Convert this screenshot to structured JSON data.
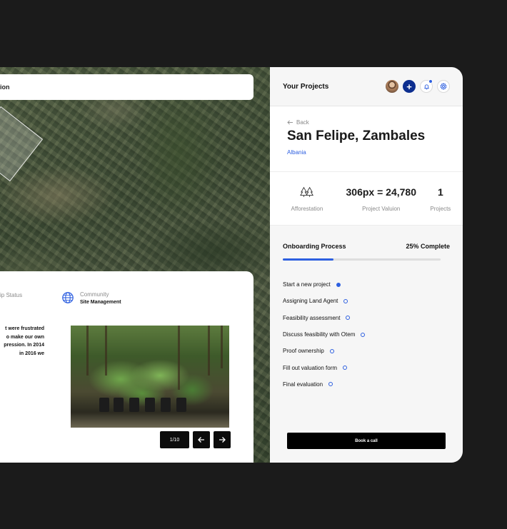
{
  "map": {
    "search_text": "ion"
  },
  "card": {
    "ownership_status_label": "ip Status",
    "community": {
      "title": "Community",
      "subtitle": "Site Management"
    },
    "story_text": "t were frustrated\no make our own\npression. In 2014\nin 2016 we",
    "pager": {
      "count": "1/10",
      "prev_icon": "arrow-left-icon",
      "next_icon": "arrow-right-icon"
    }
  },
  "panel": {
    "header": {
      "title": "Your Projects",
      "icons": [
        "avatar",
        "plus-icon",
        "bell-icon",
        "gear-icon"
      ]
    },
    "location": {
      "back_label": "Back",
      "name": "San Felipe, Zambales",
      "country": "Albania"
    },
    "stats": [
      {
        "value": "",
        "icon": "trees-icon",
        "label": "Afforestation"
      },
      {
        "value": "306px = 24,780",
        "label": "Project Valuion"
      },
      {
        "value": "1",
        "label": "Projects"
      }
    ],
    "onboarding": {
      "title": "Onboarding Process",
      "complete_label": "25% Complete",
      "progress_fraction": 0.32,
      "steps": [
        {
          "label": "Start a new project",
          "done": true
        },
        {
          "label": "Assigning Land Agent",
          "done": false
        },
        {
          "label": "Feasibility assessment",
          "done": false
        },
        {
          "label": "Discuss feasibility with Otem",
          "done": false
        },
        {
          "label": "Proof ownership",
          "done": false
        },
        {
          "label": "Fill out valuation form",
          "done": false
        },
        {
          "label": "Final evaluation",
          "done": false
        }
      ]
    },
    "book_call_label": "Book a call"
  },
  "colors": {
    "accent": "#2d5fe0",
    "brand_dark_blue": "#0d2e8f",
    "background": "#1b1b1b"
  }
}
